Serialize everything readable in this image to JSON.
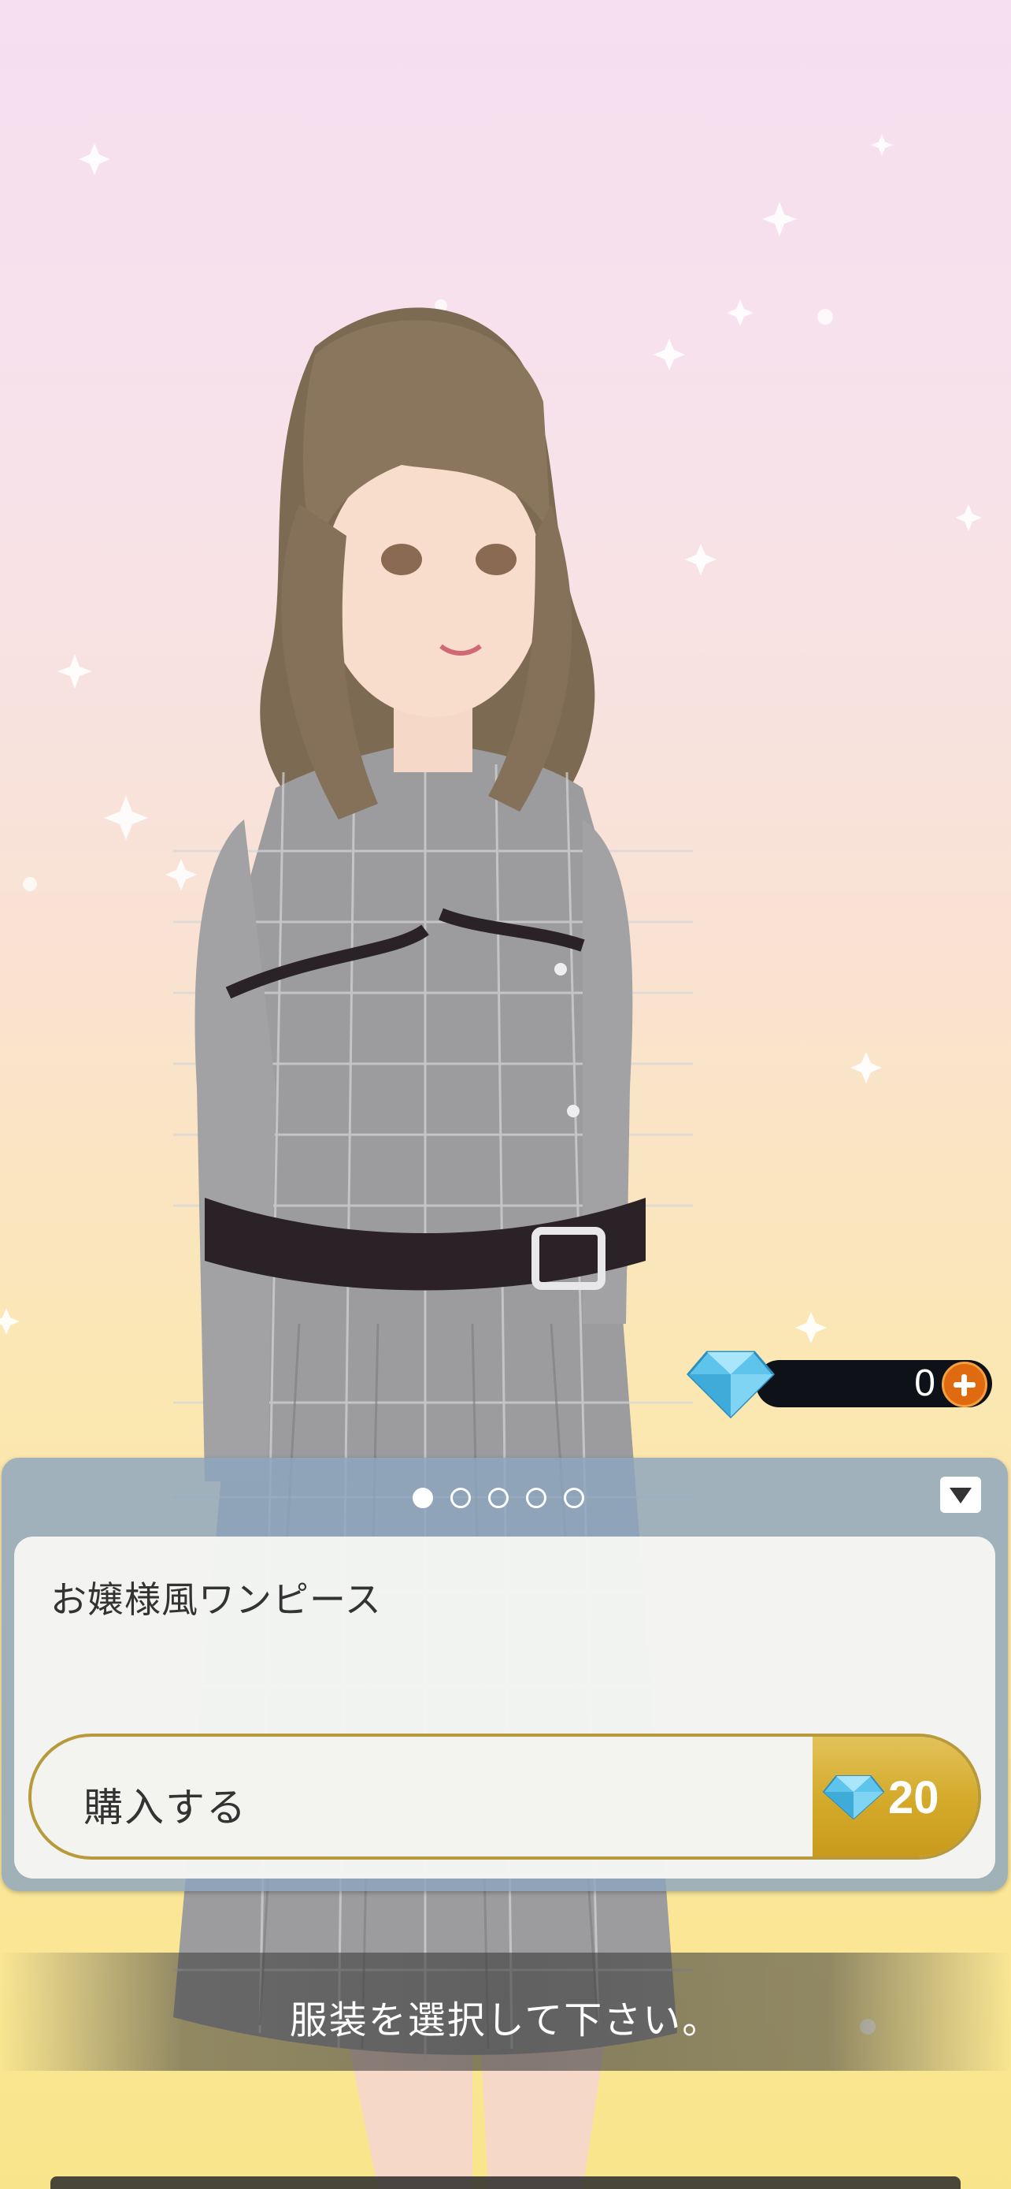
{
  "shop": {
    "gem_balance": "0",
    "item_name": "お嬢様風ワンピース",
    "buy_label": "購入する",
    "price": "20",
    "page_count": 5,
    "active_page": 1
  },
  "prompt": {
    "text": "服装を選択して下さい。"
  },
  "icons": {
    "currency": "diamond-gem-icon",
    "add": "plus-circle-icon",
    "collapse": "triangle-down-icon"
  },
  "colors": {
    "price_gold": "#d5ab2c",
    "plus_orange": "#e06a10",
    "gem_blue": "#5fc4ec"
  }
}
